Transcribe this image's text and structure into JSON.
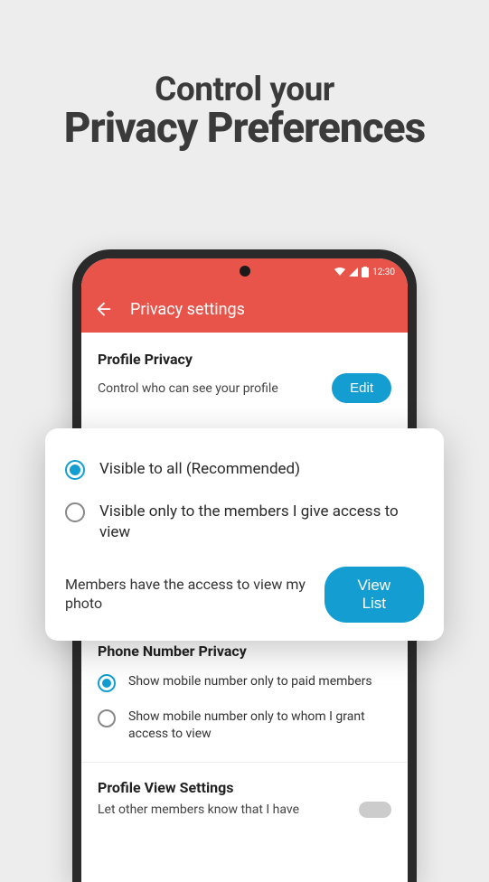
{
  "promo": {
    "line1": "Control your",
    "line2": "Privacy Preferences"
  },
  "status": {
    "time": "12:30"
  },
  "header": {
    "title": "Privacy settings"
  },
  "profilePrivacy": {
    "title": "Profile Privacy",
    "desc": "Control who can see your profile",
    "edit": "Edit"
  },
  "overlay": {
    "opt1": "Visible to all (Recommended)",
    "opt2": "Visible only to the members I give access to view",
    "accessText": "Members have the access to view my photo",
    "viewList": "View List"
  },
  "phonePrivacy": {
    "title": "Phone Number Privacy",
    "opt1": "Show mobile number only to paid members",
    "opt2": "Show mobile number only to whom I grant access to view"
  },
  "profileView": {
    "title": "Profile View Settings",
    "desc": "Let other members know that I have"
  }
}
